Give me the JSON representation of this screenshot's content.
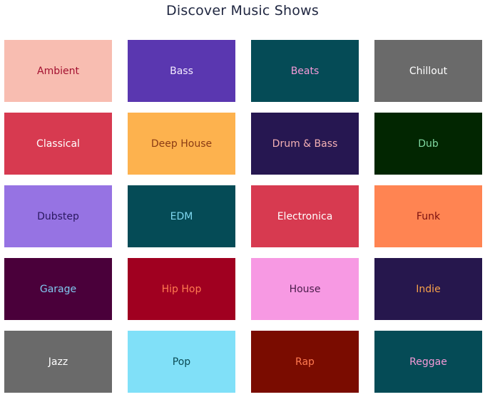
{
  "page": {
    "title": "Discover Music Shows"
  },
  "genres": [
    {
      "label": "Ambient",
      "bg": "#f8bdb1",
      "fg": "#a31030"
    },
    {
      "label": "Bass",
      "bg": "#5a37b0",
      "fg": "#f4ecff"
    },
    {
      "label": "Beats",
      "bg": "#054b56",
      "fg": "#f59ad8"
    },
    {
      "label": "Chillout",
      "bg": "#6a6a6a",
      "fg": "#ffffff"
    },
    {
      "label": "Classical",
      "bg": "#d73a50",
      "fg": "#ffffff"
    },
    {
      "label": "Deep House",
      "bg": "#fdb24e",
      "fg": "#8a3b14"
    },
    {
      "label": "Drum & Bass",
      "bg": "#261751",
      "fg": "#f3b0b4"
    },
    {
      "label": "Dub",
      "bg": "#022601",
      "fg": "#80d8a0"
    },
    {
      "label": "Dubstep",
      "bg": "#9673e3",
      "fg": "#2a1860"
    },
    {
      "label": "EDM",
      "bg": "#054b56",
      "fg": "#7fd8f0"
    },
    {
      "label": "Electronica",
      "bg": "#d73a50",
      "fg": "#ffffff"
    },
    {
      "label": "Funk",
      "bg": "#ff8452",
      "fg": "#7a1010"
    },
    {
      "label": "Garage",
      "bg": "#4a003a",
      "fg": "#80c8f0"
    },
    {
      "label": "Hip Hop",
      "bg": "#a00020",
      "fg": "#ff7a50"
    },
    {
      "label": "House",
      "bg": "#f799e3",
      "fg": "#4a1c4a"
    },
    {
      "label": "Indie",
      "bg": "#26174d",
      "fg": "#f7a24a"
    },
    {
      "label": "Jazz",
      "bg": "#6a6a6a",
      "fg": "#ffffff"
    },
    {
      "label": "Pop",
      "bg": "#80e0f8",
      "fg": "#0a4a54"
    },
    {
      "label": "Rap",
      "bg": "#7a0c00",
      "fg": "#ff7a50"
    },
    {
      "label": "Reggae",
      "bg": "#054b56",
      "fg": "#f59ad8"
    }
  ]
}
